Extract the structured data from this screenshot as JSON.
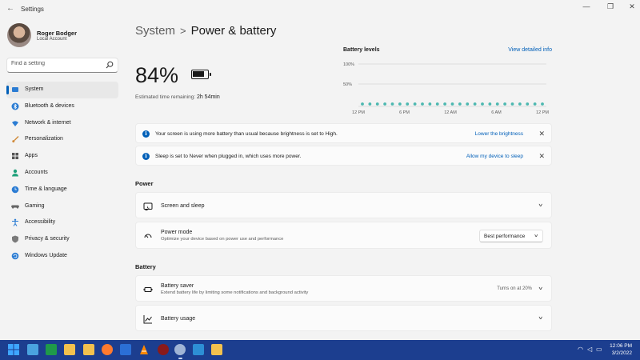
{
  "window": {
    "title": "Settings",
    "controls": [
      "minimize-icon",
      "maximize-icon",
      "close-icon"
    ]
  },
  "profile": {
    "name": "Roger Bodger",
    "account": "Local Account"
  },
  "search": {
    "placeholder": "Find a setting",
    "icon": "search-icon"
  },
  "sidebar": {
    "items": [
      {
        "label": "System",
        "icon": "system-icon",
        "color": "#2b7cd3",
        "active": true
      },
      {
        "label": "Bluetooth & devices",
        "icon": "bluetooth-icon",
        "color": "#2b7cd3"
      },
      {
        "label": "Network & internet",
        "icon": "network-icon",
        "color": "#2b7cd3"
      },
      {
        "label": "Personalization",
        "icon": "brush-icon",
        "color": "#d08a3a"
      },
      {
        "label": "Apps",
        "icon": "apps-icon",
        "color": "#555555"
      },
      {
        "label": "Accounts",
        "icon": "accounts-icon",
        "color": "#1fa07a"
      },
      {
        "label": "Time & language",
        "icon": "globe-clock-icon",
        "color": "#2b7cd3"
      },
      {
        "label": "Gaming",
        "icon": "controller-icon",
        "color": "#666666"
      },
      {
        "label": "Accessibility",
        "icon": "accessibility-icon",
        "color": "#2b7cd3"
      },
      {
        "label": "Privacy & security",
        "icon": "shield-icon",
        "color": "#7a7a7a"
      },
      {
        "label": "Windows Update",
        "icon": "update-icon",
        "color": "#2b7cd3"
      }
    ]
  },
  "header": {
    "breadcrumb_parent": "System",
    "breadcrumb_separator": ">",
    "title": "Power & battery"
  },
  "battery": {
    "percent_label": "84%",
    "level": 0.84,
    "estimate_label": "Estimated time remaining:",
    "estimate_value": "2h 54min"
  },
  "battery_chart": {
    "title": "Battery levels",
    "link": "View detailed info"
  },
  "chart_data": {
    "type": "scatter",
    "title": "Battery levels",
    "y_ticks": [
      "100%",
      "50%"
    ],
    "ylim": [
      0,
      100
    ],
    "x_ticks": [
      "12 PM",
      "6 PM",
      "12 AM",
      "6 AM",
      "12 PM"
    ],
    "point_color": "#4db8b0",
    "grid": true,
    "series": [
      {
        "values": [
          0,
          0,
          0,
          0,
          0,
          0,
          0,
          0,
          0,
          0,
          0,
          0,
          0,
          0,
          0,
          0,
          0,
          0,
          0,
          0,
          0,
          0,
          0,
          0,
          0
        ]
      }
    ]
  },
  "notices": [
    {
      "text": "Your screen is using more battery than usual because brightness is set to High.",
      "link": "Lower the brightness"
    },
    {
      "text": "Sleep is set to Never when plugged in, which uses more power.",
      "link": "Allow my device to sleep"
    }
  ],
  "power": {
    "section": "Power",
    "screen_sleep": "Screen and sleep",
    "mode_title": "Power mode",
    "mode_desc": "Optimize your device based on power use and performance",
    "mode_value": "Best performance"
  },
  "battery_section": {
    "section": "Battery",
    "saver_title": "Battery saver",
    "saver_desc": "Extend battery life by limiting some notifications and background activity",
    "saver_status": "Turns on at 20%",
    "usage_title": "Battery usage"
  },
  "taskbar": {
    "apps": [
      {
        "icon": "start-icon",
        "color": "#3ea6ff"
      },
      {
        "icon": "desktop-icon",
        "color": "#4aa3df"
      },
      {
        "icon": "spreadsheet-icon",
        "color": "#1f9a4a"
      },
      {
        "icon": "folder-icon",
        "color": "#f2c14e"
      },
      {
        "icon": "folder-icon",
        "color": "#f2c14e"
      },
      {
        "icon": "firefox-icon",
        "color": "#ff7a2e"
      },
      {
        "icon": "document-icon",
        "color": "#2b6fd6"
      },
      {
        "icon": "vlc-icon",
        "color": "#ff8800"
      },
      {
        "icon": "app-icon",
        "color": "#8a1a1a"
      },
      {
        "icon": "settings-icon",
        "color": "#9fb4d6",
        "running": true
      },
      {
        "icon": "remote-desktop-icon",
        "color": "#2d8fd5"
      },
      {
        "icon": "folder-icon",
        "color": "#f2c14e"
      }
    ],
    "tray": [
      "wifi-icon",
      "speaker-icon",
      "battery-icon"
    ],
    "time": "12:06 PM",
    "date": "3/2/2022"
  }
}
